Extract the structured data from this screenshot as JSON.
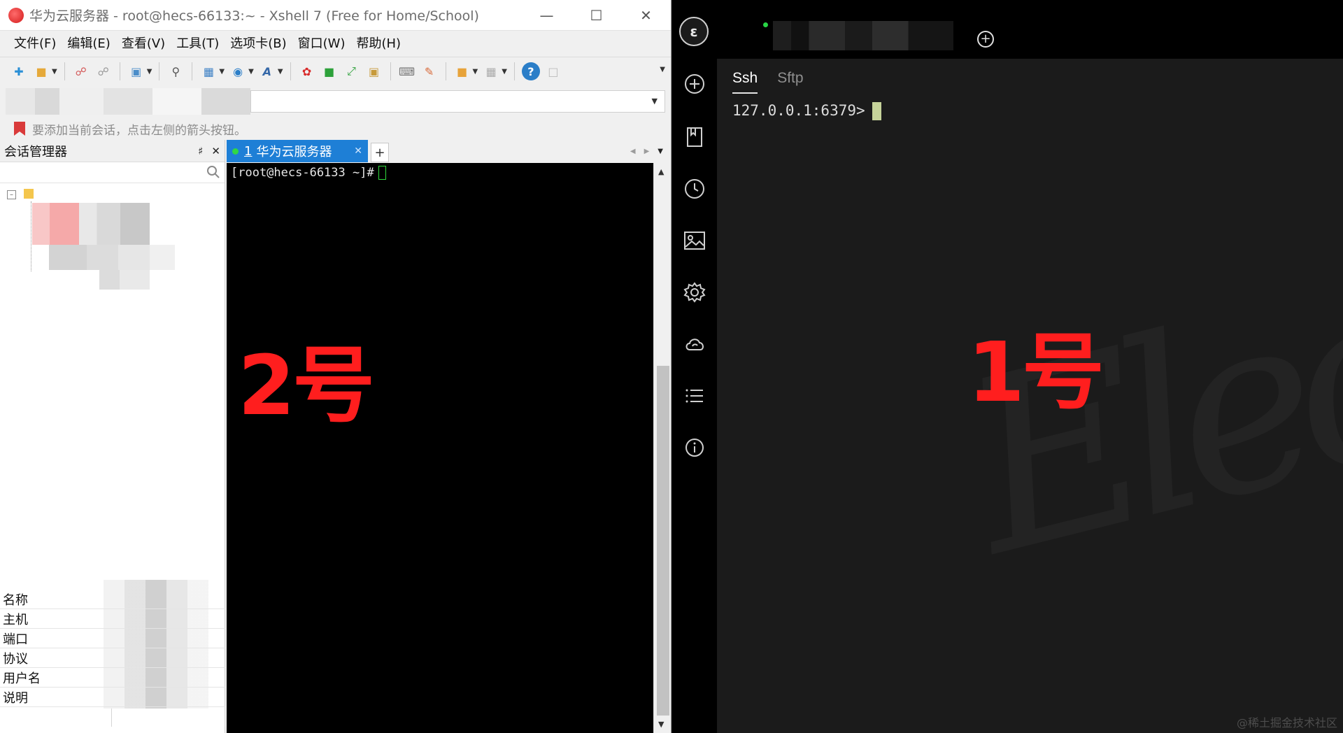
{
  "xshell": {
    "window_title": "华为云服务器 - root@hecs-66133:~ - Xshell 7 (Free for Home/School)",
    "menu": [
      "文件(F)",
      "编辑(E)",
      "查看(V)",
      "工具(T)",
      "选项卡(B)",
      "窗口(W)",
      "帮助(H)"
    ],
    "hint": "要添加当前会话，点击左侧的箭头按钮。",
    "session_manager": {
      "title": "会话管理器",
      "properties": [
        "名称",
        "主机",
        "端口",
        "协议",
        "用户名",
        "说明"
      ]
    },
    "tab": {
      "number": "1",
      "label": "华为云服务器"
    },
    "terminal": {
      "prompt": "[root@hecs-66133 ~]#"
    },
    "overlay_label": "2号"
  },
  "electerm": {
    "subtabs": [
      "Ssh",
      "Sftp"
    ],
    "prompt": "127.0.0.1:6379>",
    "watermark": "Elec",
    "overlay_label": "1号",
    "footer": "@稀土掘金技术社区"
  },
  "colors": {
    "xshell_tab_active": "#1e7fd6",
    "label_red": "#ff1e1e",
    "electerm_bg": "#1b1b1b",
    "cursor_green": "#2fd93c",
    "electerm_cursor": "#c6d39a"
  }
}
